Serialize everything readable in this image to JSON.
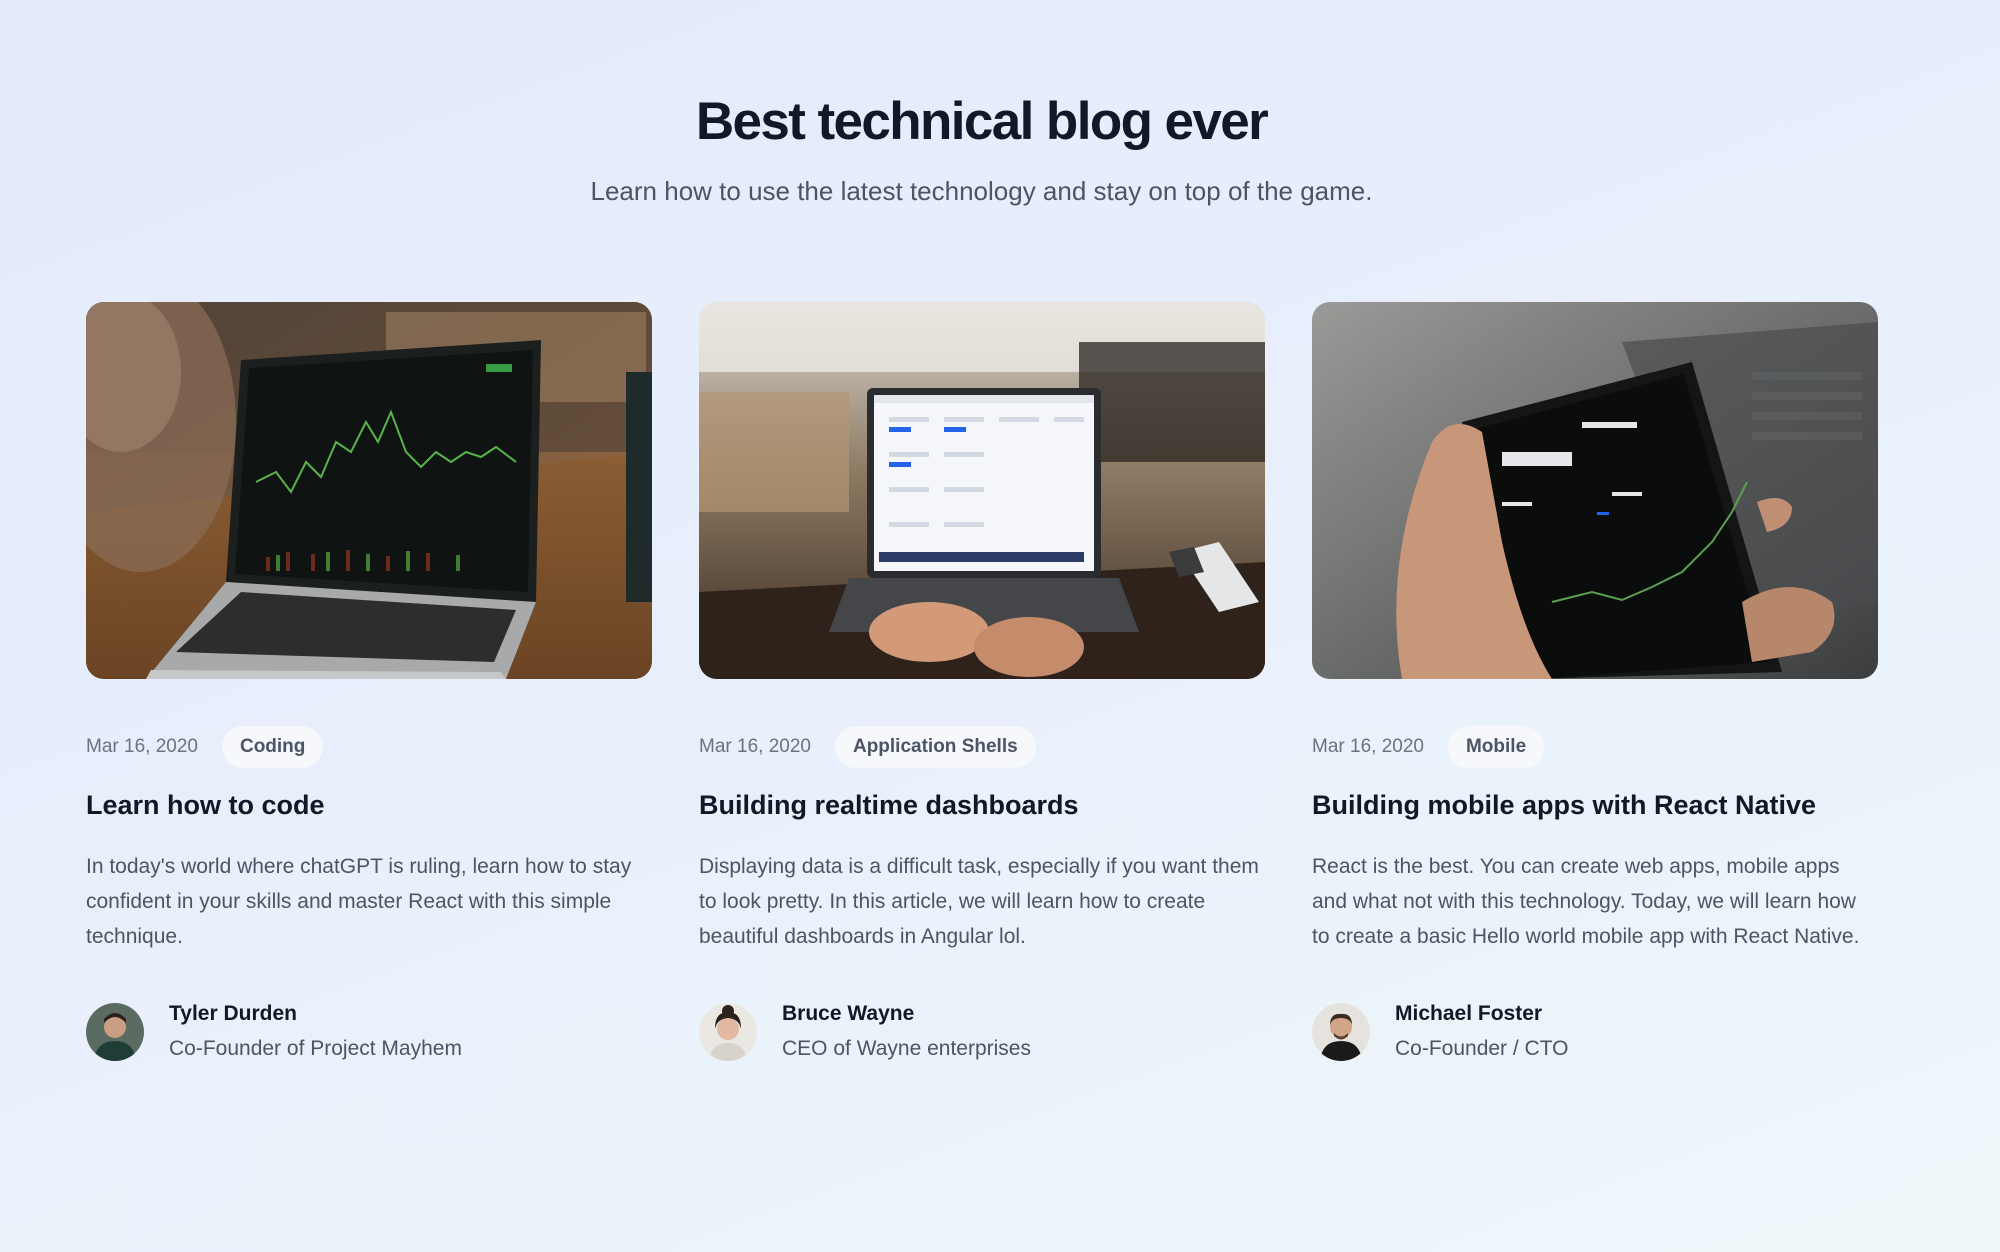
{
  "header": {
    "title": "Best technical blog ever",
    "subtitle": "Learn how to use the latest technology and stay on top of the game."
  },
  "posts": [
    {
      "image_icon": "laptop-chart-photo",
      "date": "Mar 16, 2020",
      "category": "Coding",
      "title": "Learn how to code",
      "description": "In today's world where chatGPT is ruling, learn how to stay confident in your skills and master React with this simple technique.",
      "author": {
        "name": "Tyler Durden",
        "role": "Co-Founder of Project Mayhem",
        "avatar_icon": "avatar-photo"
      }
    },
    {
      "image_icon": "laptop-dashboard-photo",
      "date": "Mar 16, 2020",
      "category": "Application Shells",
      "title": "Building realtime dashboards",
      "description": "Displaying data is a difficult task, especially if you want them to look pretty. In this article, we will learn how to create beautiful dashboards in Angular lol.",
      "author": {
        "name": "Bruce Wayne",
        "role": "CEO of Wayne enterprises",
        "avatar_icon": "avatar-photo"
      }
    },
    {
      "image_icon": "phone-stock-app-photo",
      "date": "Mar 16, 2020",
      "category": "Mobile",
      "title": "Building mobile apps with React Native",
      "description": "React is the best. You can create web apps, mobile apps and what not with this technology. Today, we will learn how to create a basic Hello world mobile app with React Native.",
      "author": {
        "name": "Michael Foster",
        "role": "Co-Founder / CTO",
        "avatar_icon": "avatar-photo"
      }
    }
  ],
  "colors": {
    "title": "#111827",
    "body_text": "#4b5563",
    "muted": "#6b7280",
    "tag_bg": "#f6f8fc",
    "background_start": "#e3eafb",
    "background_end": "#eef7fa"
  }
}
